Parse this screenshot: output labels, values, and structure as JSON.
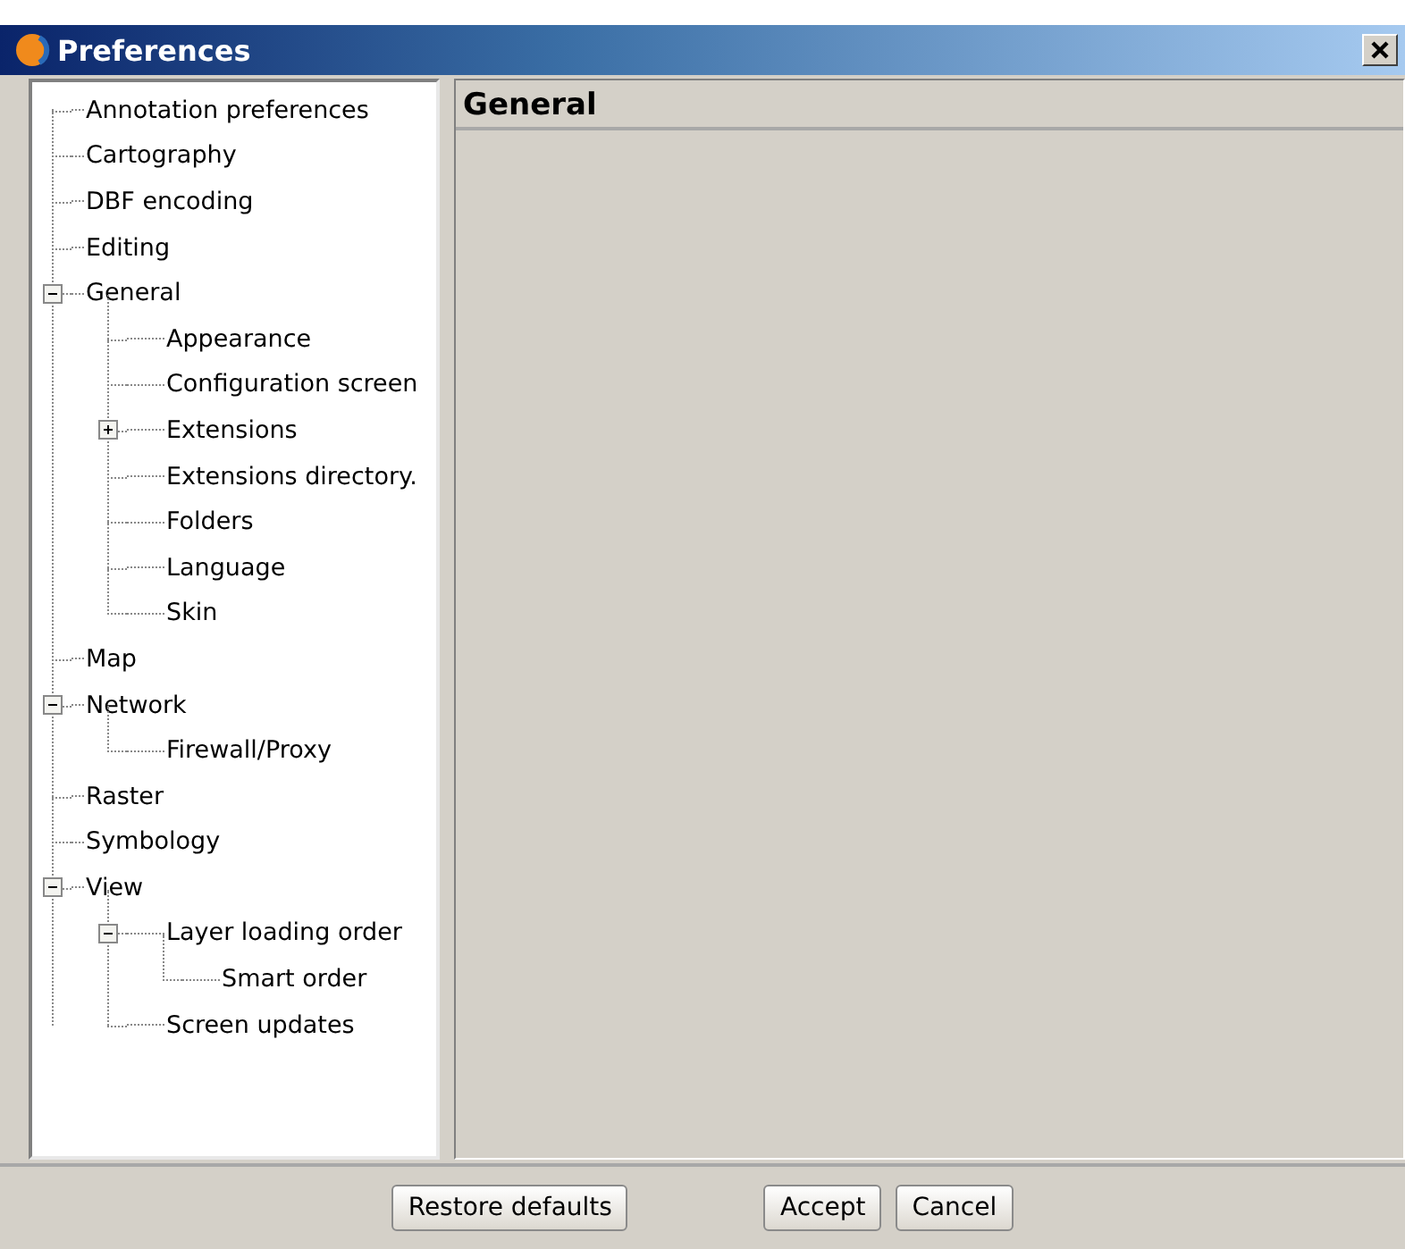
{
  "window": {
    "title": "Preferences"
  },
  "tree": [
    {
      "label": "Annotation preferences",
      "selected": false
    },
    {
      "label": "Cartography",
      "selected": false
    },
    {
      "label": "DBF encoding",
      "selected": false
    },
    {
      "label": "Editing",
      "selected": false
    },
    {
      "label": "General",
      "selected": false,
      "expanded": true,
      "children": [
        {
          "label": "Appearance",
          "selected": false
        },
        {
          "label": "Configuration screen",
          "selected": false
        },
        {
          "label": "Extensions",
          "selected": false,
          "expanded": false
        },
        {
          "label": "Extensions directory.",
          "selected": false
        },
        {
          "label": "Folders",
          "selected": false
        },
        {
          "label": "Language",
          "selected": false
        },
        {
          "label": "Skin",
          "selected": false
        }
      ]
    },
    {
      "label": "Map",
      "selected": false
    },
    {
      "label": "Network",
      "selected": false,
      "expanded": true,
      "children": [
        {
          "label": "Firewall/Proxy",
          "selected": false
        }
      ]
    },
    {
      "label": "Raster",
      "selected": false
    },
    {
      "label": "Symbology",
      "selected": false
    },
    {
      "label": "View",
      "selected": false,
      "expanded": true,
      "children": [
        {
          "label": "Layer loading order",
          "selected": false,
          "expanded": true,
          "children": [
            {
              "label": "Smart order",
              "selected": false
            }
          ]
        },
        {
          "label": "Screen updates",
          "selected": false
        }
      ]
    }
  ],
  "panel": {
    "title": "General"
  },
  "buttons": [
    {
      "label": "Restore defaults"
    },
    {
      "label": "Accept"
    },
    {
      "label": "Cancel"
    }
  ]
}
